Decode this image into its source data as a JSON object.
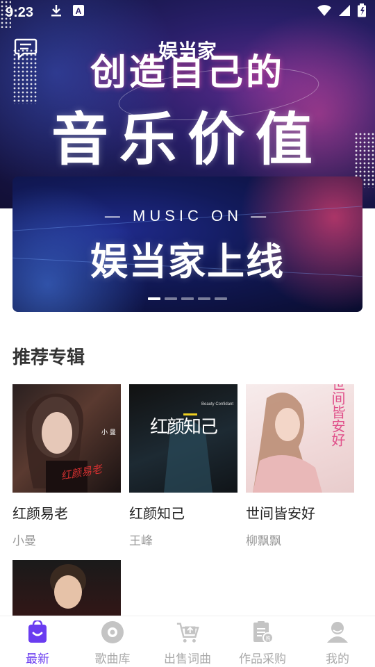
{
  "status_bar": {
    "time": "9:23",
    "left_icons": [
      "download-icon",
      "a-badge-icon"
    ],
    "right_icons": [
      "wifi-icon",
      "signal-icon",
      "battery-icon"
    ]
  },
  "header": {
    "app_title": "娱当家",
    "slogan_line1": "创造自己的",
    "slogan_line2": "音乐价值"
  },
  "banner": {
    "subtitle": "— MUSIC ON —",
    "title": "娱当家上线",
    "page_count": 5,
    "active_page": 1
  },
  "section": {
    "title": "推荐专辑"
  },
  "albums": [
    {
      "name": "红颜易老",
      "artist": "小曼",
      "cover_text": "红颜易老",
      "cover_sub": "小 曼"
    },
    {
      "name": "红颜知己",
      "artist": "王峰",
      "cover_text": "红颜知己",
      "cover_sub": "Beauty Confidant"
    },
    {
      "name": "世间皆安好",
      "artist": "柳飘飘",
      "cover_text": "世间皆安好",
      "cover_sub": ""
    },
    {
      "name": "",
      "artist": "",
      "cover_text": "",
      "cover_sub": ""
    }
  ],
  "bottom_nav": {
    "active": 0,
    "accent_color": "#6a3cf0",
    "items": [
      {
        "label": "最新",
        "icon": "smile-bag-icon"
      },
      {
        "label": "歌曲库",
        "icon": "disc-icon"
      },
      {
        "label": "出售词曲",
        "icon": "cart-icon"
      },
      {
        "label": "作品采购",
        "icon": "purchase-doc-icon"
      },
      {
        "label": "我的",
        "icon": "user-icon"
      }
    ]
  }
}
